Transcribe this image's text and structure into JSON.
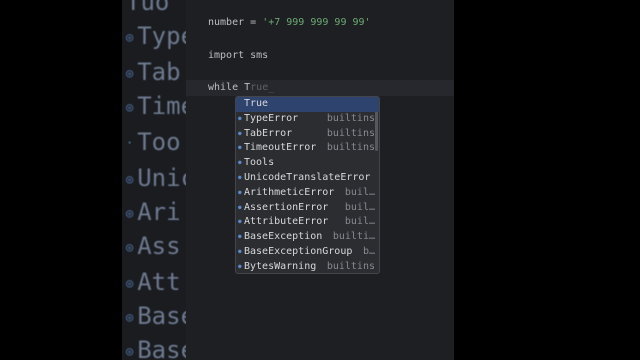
{
  "background": {
    "words": [
      "Tuo",
      "Type",
      "Tab",
      "Time",
      "Too",
      "Unic",
      "Ari",
      "Ass",
      "Att",
      "Base",
      "Base"
    ]
  },
  "editor": {
    "line1": {
      "code": "number = ",
      "string": "'+7 999 999 99 99'"
    },
    "line2": "import sms",
    "line3": {
      "typed": "while T",
      "ghost": "rue_"
    }
  },
  "completion": {
    "items": [
      {
        "label": "True",
        "tail": ""
      },
      {
        "label": "TypeError",
        "tail": "builtins"
      },
      {
        "label": "TabError",
        "tail": "builtins"
      },
      {
        "label": "TimeoutError",
        "tail": "builtins"
      },
      {
        "label": "Tools",
        "tail": ""
      },
      {
        "label": "UnicodeTranslateError",
        "tail": ""
      },
      {
        "label": "ArithmeticError",
        "tail": "buil…"
      },
      {
        "label": "AssertionError",
        "tail": "buil…"
      },
      {
        "label": "AttributeError",
        "tail": "buil…"
      },
      {
        "label": "BaseException",
        "tail": "builti…"
      },
      {
        "label": "BaseExceptionGroup",
        "tail": "b…"
      },
      {
        "label": "BytesWarning",
        "tail": "builtins"
      }
    ]
  },
  "colors": {
    "selection": "#2e436e",
    "string": "#6aab73",
    "editor_bg": "#1e1f22"
  }
}
